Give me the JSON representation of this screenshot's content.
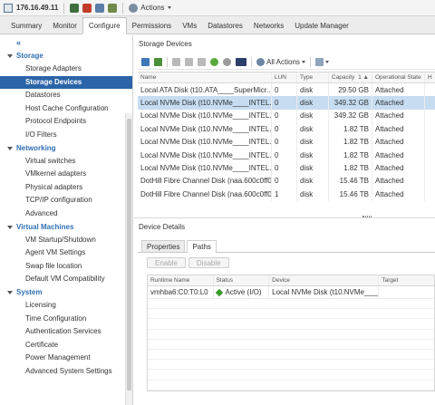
{
  "topbar": {
    "host": "176.16.49.11",
    "actions_label": "Actions",
    "icons": [
      "host-icon",
      "maintenance-icon",
      "power-icon",
      "vm-icon",
      "migrate-icon",
      "settings-icon"
    ]
  },
  "tabs": [
    "Summary",
    "Monitor",
    "Configure",
    "Permissions",
    "VMs",
    "Datastores",
    "Networks",
    "Update Manager"
  ],
  "active_tab": "Configure",
  "sidebar": {
    "collapse": "«",
    "sections": [
      {
        "title": "Storage",
        "items": [
          "Storage Adapters",
          "Storage Devices",
          "Datastores",
          "Host Cache Configuration",
          "Protocol Endpoints",
          "I/O Filters"
        ]
      },
      {
        "title": "Networking",
        "items": [
          "Virtual switches",
          "VMkernel adapters",
          "Physical adapters",
          "TCP/IP configuration",
          "Advanced"
        ]
      },
      {
        "title": "Virtual Machines",
        "items": [
          "VM Startup/Shutdown",
          "Agent VM Settings",
          "Swap file location",
          "Default VM Compatibility"
        ]
      },
      {
        "title": "System",
        "items": [
          "Licensing",
          "Time Configuration",
          "Authentication Services",
          "Certificate",
          "Power Management",
          "Advanced System Settings"
        ]
      }
    ],
    "active_item": "Storage Devices"
  },
  "storage": {
    "title": "Storage Devices",
    "all_actions": "All Actions",
    "columns": [
      "Name",
      "LUN",
      "Type",
      "Capacity",
      "Operational State",
      "H"
    ],
    "sort_mark": "1 ▲",
    "rows": [
      {
        "name": "Local ATA Disk (t10.ATA____SuperMicr...",
        "lun": "0",
        "type": "disk",
        "capacity": "29.50 GB",
        "state": "Attached"
      },
      {
        "name": "Local NVMe Disk (t10.NVMe____INTEL...",
        "lun": "0",
        "type": "disk",
        "capacity": "349.32 GB",
        "state": "Attached"
      },
      {
        "name": "Local NVMe Disk (t10.NVMe____INTEL...",
        "lun": "0",
        "type": "disk",
        "capacity": "349.32 GB",
        "state": "Attached"
      },
      {
        "name": "Local NVMe Disk (t10.NVMe____INTEL...",
        "lun": "0",
        "type": "disk",
        "capacity": "1.82 TB",
        "state": "Attached"
      },
      {
        "name": "Local NVMe Disk (t10.NVMe____INTEL...",
        "lun": "0",
        "type": "disk",
        "capacity": "1.82 TB",
        "state": "Attached"
      },
      {
        "name": "Local NVMe Disk (t10.NVMe____INTEL...",
        "lun": "0",
        "type": "disk",
        "capacity": "1.82 TB",
        "state": "Attached"
      },
      {
        "name": "Local NVMe Disk (t10.NVMe____INTEL...",
        "lun": "0",
        "type": "disk",
        "capacity": "1.82 TB",
        "state": "Attached"
      },
      {
        "name": "DotHill Fibre Channel Disk (naa.600c0ff0...",
        "lun": "0",
        "type": "disk",
        "capacity": "15.46 TB",
        "state": "Attached"
      },
      {
        "name": "DotHill Fibre Channel Disk (naa.600c0ff0...",
        "lun": "1",
        "type": "disk",
        "capacity": "15.46 TB",
        "state": "Attached"
      }
    ],
    "selected_row": 1
  },
  "details": {
    "title": "Device Details",
    "tabs": [
      "Properties",
      "Paths"
    ],
    "active_tab": "Paths",
    "buttons": [
      "Enable",
      "Disable"
    ],
    "columns": [
      "Runtime Name",
      "Status",
      "Device",
      "Target"
    ],
    "rows": [
      {
        "runtime": "vmhba6:C0:T0:L0",
        "status": "Active (I/O)",
        "device": "Local NVMe Disk (t10.NVMe____INTEL...",
        "target": ""
      }
    ]
  },
  "colors": {
    "accent": "#2b64a8",
    "selected_row": "#c6dcf1",
    "active_status": "#3a9a2a"
  }
}
